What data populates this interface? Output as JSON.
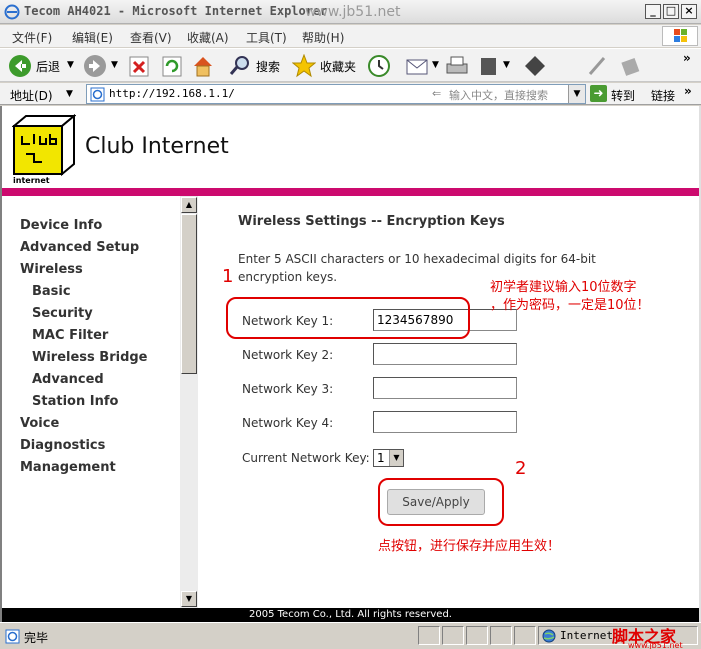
{
  "window": {
    "title": "Tecom AH4021 - Microsoft Internet Explorer",
    "watermark": "www.jb51.net"
  },
  "menu": [
    "文件(F)",
    "编辑(E)",
    "查看(V)",
    "收藏(A)",
    "工具(T)",
    "帮助(H)"
  ],
  "toolbar": {
    "back_label": "后退",
    "search_label": "搜索",
    "favorites_label": "收藏夹"
  },
  "address": {
    "label": "地址(D)",
    "url": "http://192.168.1.1/",
    "hint": "输入中文，直接搜索",
    "go_label": "转到",
    "links_label": "链接"
  },
  "brand": {
    "name": "Club Internet"
  },
  "nav": {
    "items": [
      {
        "label": "Device Info",
        "level": 0
      },
      {
        "label": "Advanced Setup",
        "level": 0
      },
      {
        "label": "Wireless",
        "level": 0
      },
      {
        "label": "Basic",
        "level": 1
      },
      {
        "label": "Security",
        "level": 1
      },
      {
        "label": "MAC Filter",
        "level": 1
      },
      {
        "label": "Wireless Bridge",
        "level": 1
      },
      {
        "label": "Advanced",
        "level": 1
      },
      {
        "label": "Station Info",
        "level": 1
      },
      {
        "label": "Voice",
        "level": 0
      },
      {
        "label": "Diagnostics",
        "level": 0
      },
      {
        "label": "Management",
        "level": 0
      }
    ]
  },
  "content": {
    "title": "Wireless Settings -- Encryption Keys",
    "description": "Enter 5 ASCII characters or 10 hexadecimal digits for 64-bit encryption keys.",
    "keys": [
      {
        "label": "Network Key 1:",
        "value": "1234567890"
      },
      {
        "label": "Network Key 2:",
        "value": ""
      },
      {
        "label": "Network Key 3:",
        "value": ""
      },
      {
        "label": "Network Key 4:",
        "value": ""
      }
    ],
    "current_key_label": "Current Network Key:",
    "current_key_value": "1",
    "save_label": "Save/Apply"
  },
  "annotations": {
    "num1": "1",
    "note1_line1": "初学者建议输入10位数字",
    "note1_line2": "，作为密码，一定是10位！",
    "num2": "2",
    "note2": "点按钮，进行保存并应用生效！"
  },
  "footer": "2005 Tecom Co., Ltd. All rights reserved.",
  "status": {
    "text": "完毕",
    "zone": "Internet"
  },
  "corner_watermark": {
    "cn": "脚本之家",
    "url": "www.jb51.net"
  },
  "colors": {
    "accent_bar": "#cc0a6e",
    "annotation": "#e00000"
  }
}
